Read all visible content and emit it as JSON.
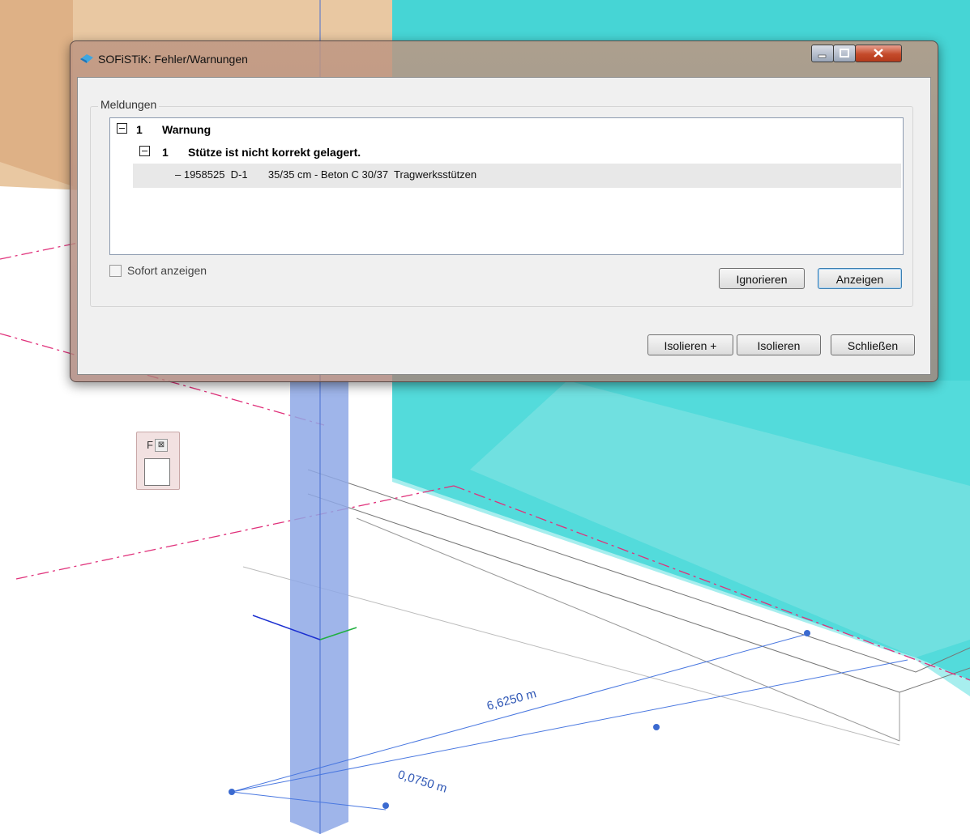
{
  "window": {
    "title": "SOFiSTiK: Fehler/Warnungen",
    "minimize": "–",
    "maximize": "□",
    "close": "X"
  },
  "messages_group": {
    "label": "Meldungen",
    "items": [
      {
        "index": "1",
        "title": "Warnung",
        "children": [
          {
            "index": "1",
            "title": "Stütze ist nicht korrekt gelagert.",
            "detail": "– 1958525  D-1       35/35 cm - Beton C 30/37  Tragwerksstützen"
          }
        ]
      }
    ]
  },
  "options": {
    "show_immediately": "Sofort anzeigen"
  },
  "buttons": {
    "ignore": "Ignorieren",
    "show": "Anzeigen",
    "isolate_plus": "Isolieren +",
    "isolate": "Isolieren",
    "close": "Schließen"
  },
  "palette": {
    "label": "F",
    "close": "⊠"
  },
  "viewport": {
    "dimension_1": "6,6250 m",
    "dimension_2": "0,0750 m"
  }
}
